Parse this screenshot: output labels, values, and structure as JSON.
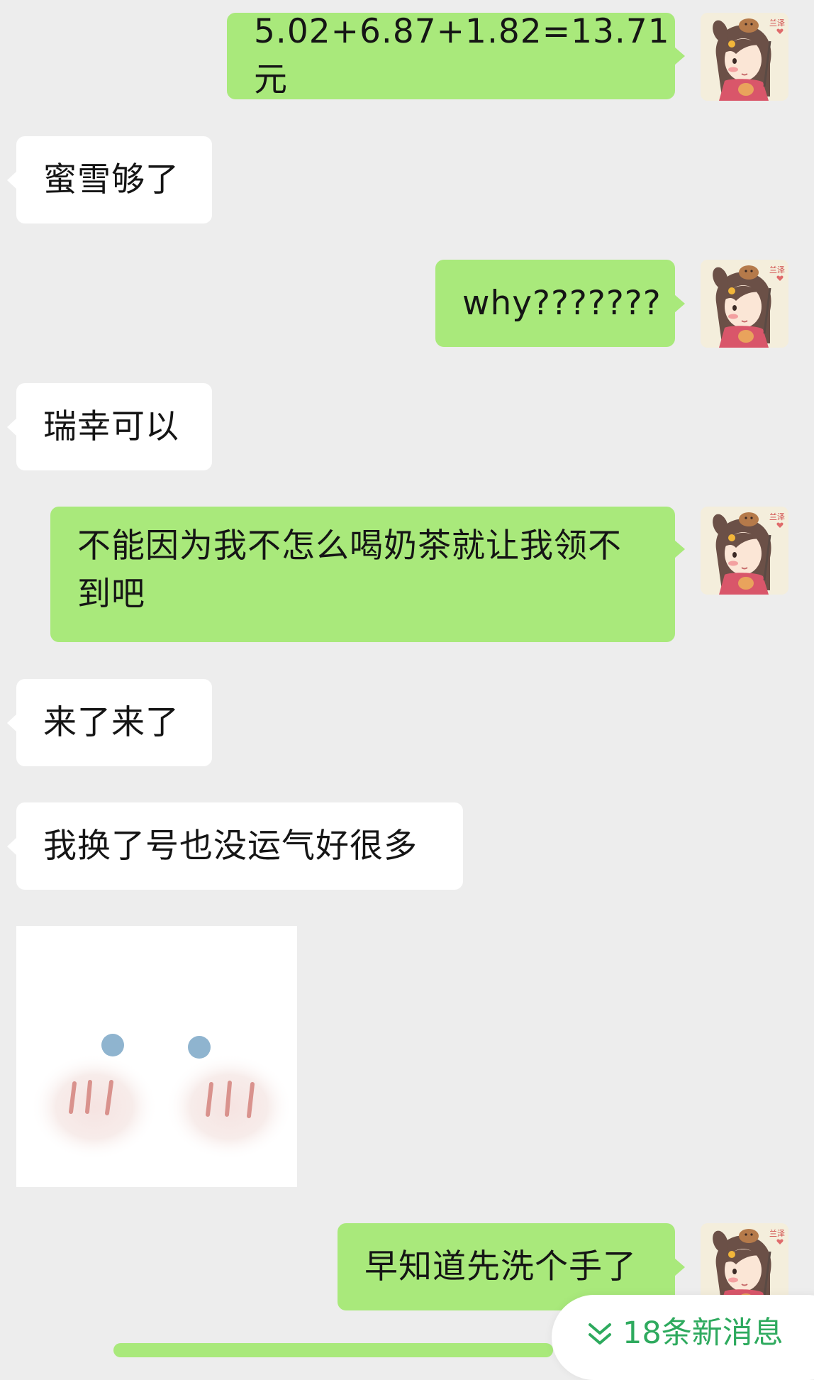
{
  "messages": [
    {
      "id": "m1",
      "side": "out",
      "text": "5.02+6.87+1.82=13.71元"
    },
    {
      "id": "m2",
      "side": "in",
      "text": "蜜雪够了"
    },
    {
      "id": "m3",
      "side": "out",
      "text": "why???????"
    },
    {
      "id": "m4",
      "side": "in",
      "text": "瑞幸可以"
    },
    {
      "id": "m5",
      "side": "out",
      "text": "不能因为我不怎么喝奶茶就让我领不到吧"
    },
    {
      "id": "m6",
      "side": "in",
      "text": "来了来了"
    },
    {
      "id": "m7",
      "side": "in",
      "text": "我换了号也没运气好很多"
    },
    {
      "id": "m8",
      "side": "in",
      "type": "sticker",
      "sticker": "blushing-face-sticker"
    },
    {
      "id": "m9",
      "side": "out",
      "text": "早知道先洗个手了"
    }
  ],
  "avatar": {
    "watermark": "兰泽",
    "icon": "girl-cartoon-avatar"
  },
  "new_messages": {
    "label": "18条新消息",
    "icon": "double-chevron-down-icon"
  },
  "colors": {
    "background": "#ededed",
    "outgoing_bubble": "#a9e97b",
    "incoming_bubble": "#ffffff",
    "new_messages_text": "#2eaa5e"
  }
}
